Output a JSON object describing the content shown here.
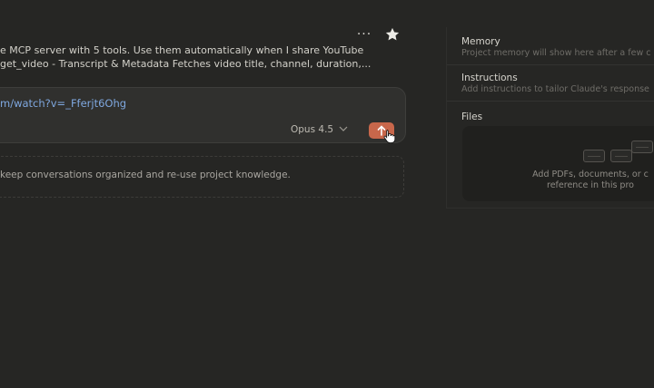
{
  "header": {
    "more_label": "···"
  },
  "project": {
    "description_line1": "e MCP server with 5 tools. Use them automatically when I share YouTube",
    "description_line2": "get_video - Transcript & Metadata Fetches video title, channel, duration,..."
  },
  "composer": {
    "input_value": "m/watch?v=_Fferjt6Ohg",
    "model_label": "Opus 4.5"
  },
  "tip": {
    "text": "keep conversations organized and re-use project knowledge."
  },
  "sidebar": {
    "memory_title": "Memory",
    "memory_sub": "Project memory will show here after a few c",
    "instructions_title": "Instructions",
    "instructions_sub": "Add instructions to tailor Claude's response",
    "files_title": "Files",
    "files_hint_line1": "Add PDFs, documents, or c",
    "files_hint_line2": "reference in this pro"
  },
  "colors": {
    "background": "#262624",
    "accent": "#c8674b",
    "link": "#7fa8e0"
  }
}
